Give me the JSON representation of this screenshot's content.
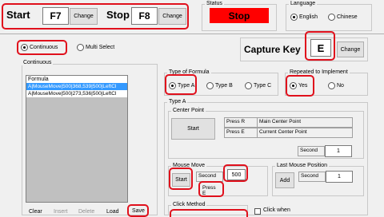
{
  "hotkeys": {
    "start_label": "Start",
    "start_key": "F7",
    "stop_label": "Stop",
    "stop_key": "F8",
    "change_label": "Change"
  },
  "status": {
    "title": "Status",
    "value": "Stop",
    "color": "#ff0000"
  },
  "language": {
    "title": "Language",
    "options": [
      "English",
      "Chinese"
    ],
    "selected": "English"
  },
  "mode": {
    "options": [
      "Continuous",
      "Multi Select"
    ],
    "selected": "Continuous"
  },
  "capture": {
    "label": "Capture Key",
    "key": "E",
    "change_label": "Change"
  },
  "continuous_panel": {
    "title": "Continuous",
    "list_header": "Formula",
    "list_items": [
      "A|MouseMove|500|368,539|500|LeftCl",
      "A|MouseMove|500|273,536|500|LeftCl"
    ],
    "selected_index": 0,
    "buttons": [
      "Clear",
      "Insert",
      "Delete",
      "Load",
      "Save"
    ]
  },
  "formula_type": {
    "title": "Type of Formula",
    "options": [
      "Type A",
      "Type B",
      "Type C"
    ],
    "selected": "Type A"
  },
  "repeat": {
    "title": "Repeated to Implement",
    "options": [
      "Yes",
      "No"
    ],
    "selected": "Yes"
  },
  "type_a": {
    "title": "Type A",
    "center_point": {
      "title": "Center Point",
      "start_label": "Start",
      "rows": [
        [
          "Press R",
          "Main Center Point"
        ],
        [
          "Press E",
          "Current Center Point"
        ]
      ],
      "second_label": "Second",
      "second_value": "1"
    },
    "mouse_move": {
      "title": "Mouse Move",
      "start_label": "Start",
      "second_label": "Second",
      "second_value": "500",
      "press_label": "Press E"
    },
    "last_mouse": {
      "title": "Last Mouse Position",
      "add_label": "Add",
      "second_label": "Second",
      "second_value": "1"
    },
    "click_method": {
      "title": "Click Method"
    },
    "click_when": {
      "label": "Click when"
    }
  }
}
